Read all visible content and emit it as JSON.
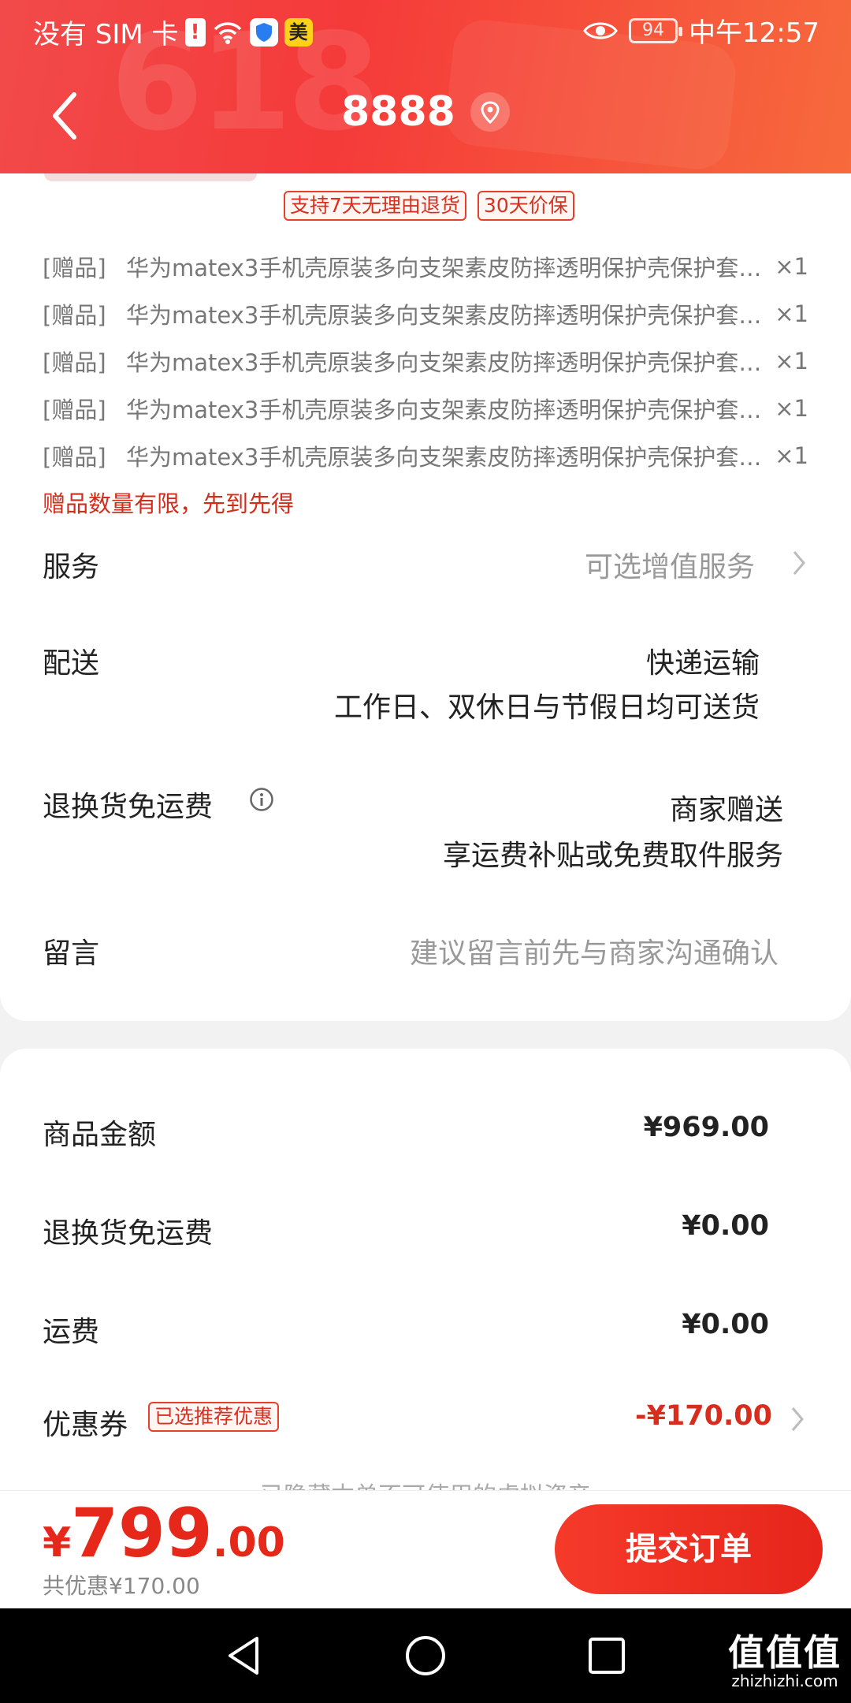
{
  "status_bar": {
    "carrier": "没有 SIM 卡",
    "alert": "!",
    "app_badge": "美",
    "battery": "94",
    "time": "中午12:57"
  },
  "header": {
    "title": "8888",
    "decoration": "618"
  },
  "badges": [
    "支持7天无理由退货",
    "30天价保"
  ],
  "gifts": [
    {
      "tag": "[赠品]",
      "name": "华为matex3手机壳原装多向支架素皮防摔透明保护壳保护套x…",
      "qty": "×1"
    },
    {
      "tag": "[赠品]",
      "name": "华为matex3手机壳原装多向支架素皮防摔透明保护壳保护套x…",
      "qty": "×1"
    },
    {
      "tag": "[赠品]",
      "name": "华为matex3手机壳原装多向支架素皮防摔透明保护壳保护套x…",
      "qty": "×1"
    },
    {
      "tag": "[赠品]",
      "name": "华为matex3手机壳原装多向支架素皮防摔透明保护壳保护套x…",
      "qty": "×1"
    },
    {
      "tag": "[赠品]",
      "name": "华为matex3手机壳原装多向支架素皮防摔透明保护壳保护套x…",
      "qty": "×1"
    }
  ],
  "gift_note": "赠品数量有限，先到先得",
  "service": {
    "label": "服务",
    "value": "可选增值服务"
  },
  "delivery": {
    "label": "配送",
    "method": "快递运输",
    "schedule": "工作日、双休日与节假日均可送货"
  },
  "return_shipping": {
    "label": "退换货免运费",
    "provider": "商家赠送",
    "detail": "享运费补贴或免费取件服务"
  },
  "message": {
    "label": "留言",
    "placeholder": "建议留言前先与商家沟通确认"
  },
  "summary": {
    "goods_label": "商品金额",
    "goods_value": "¥969.00",
    "return_label": "退换货免运费",
    "return_value": "¥0.00",
    "shipping_label": "运费",
    "shipping_value": "¥0.00",
    "coupon_label": "优惠券",
    "coupon_tag": "已选推荐优惠",
    "coupon_value": "-¥170.00",
    "hidden_hint": "已隐藏本单不可使用的虚拟资产"
  },
  "checkout": {
    "currency": "¥",
    "price_int": "799",
    "price_dec": ".00",
    "saving": "共优惠¥170.00",
    "submit_label": "提交订单"
  },
  "watermark": {
    "big": "值值值",
    "small": "zhizhizhi.com"
  }
}
